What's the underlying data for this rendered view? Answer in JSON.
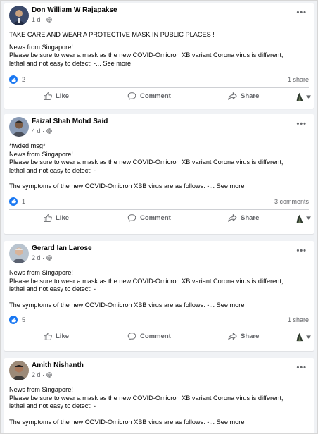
{
  "colors": {
    "accent": "#1877f2",
    "muted": "#65676b",
    "divider": "#ced0d4"
  },
  "actions": {
    "like": "Like",
    "comment": "Comment",
    "share": "Share"
  },
  "see_more": "See more",
  "posts": [
    {
      "author": "Don William W Rajapakse",
      "time": "1 d ·",
      "lines": [
        "TAKE CARE AND WEAR  A PROTECTIVE MASK IN PUBLIC PLACES !",
        "News from Singapore!",
        "Please be sure to wear a mask as the new COVID-Omicron XB variant Corona virus is different,",
        "lethal and not easy to detect: -..."
      ],
      "reactions": "2",
      "right_stat": "1 share"
    },
    {
      "author": "Faizal Shah Mohd Said",
      "time": "4 d ·",
      "lines": [
        "*fwded msg*",
        "News from Singapore!",
        "Please be sure to wear a mask as the new COVID-Omicron XB variant Corona virus is different,",
        "lethal and not easy to detect: -"
      ],
      "extra": "The symptoms of the new COVID-Omicron XBB virus are as follows: -...",
      "reactions": "1",
      "right_stat": "3 comments"
    },
    {
      "author": "Gerard Ian Larose",
      "time": "2 d ·",
      "lines": [
        "News from Singapore!",
        "Please be sure to wear a mask as the new COVID-Omicron XB variant Corona virus is different,",
        "lethal and not easy to detect: -"
      ],
      "extra": "The symptoms of the new COVID-Omicron XBB virus are as follows: -...",
      "reactions": "5",
      "right_stat": "1 share"
    },
    {
      "author": "Amith Nishanth",
      "time": "2 d ·",
      "lines": [
        "News from Singapore!",
        "Please be sure to wear a mask as the new COVID-Omicron XB variant Corona virus is different,",
        "lethal and not easy to detect: -"
      ],
      "extra": "The symptoms of the new COVID-Omicron XBB virus are as follows: -..."
    }
  ]
}
